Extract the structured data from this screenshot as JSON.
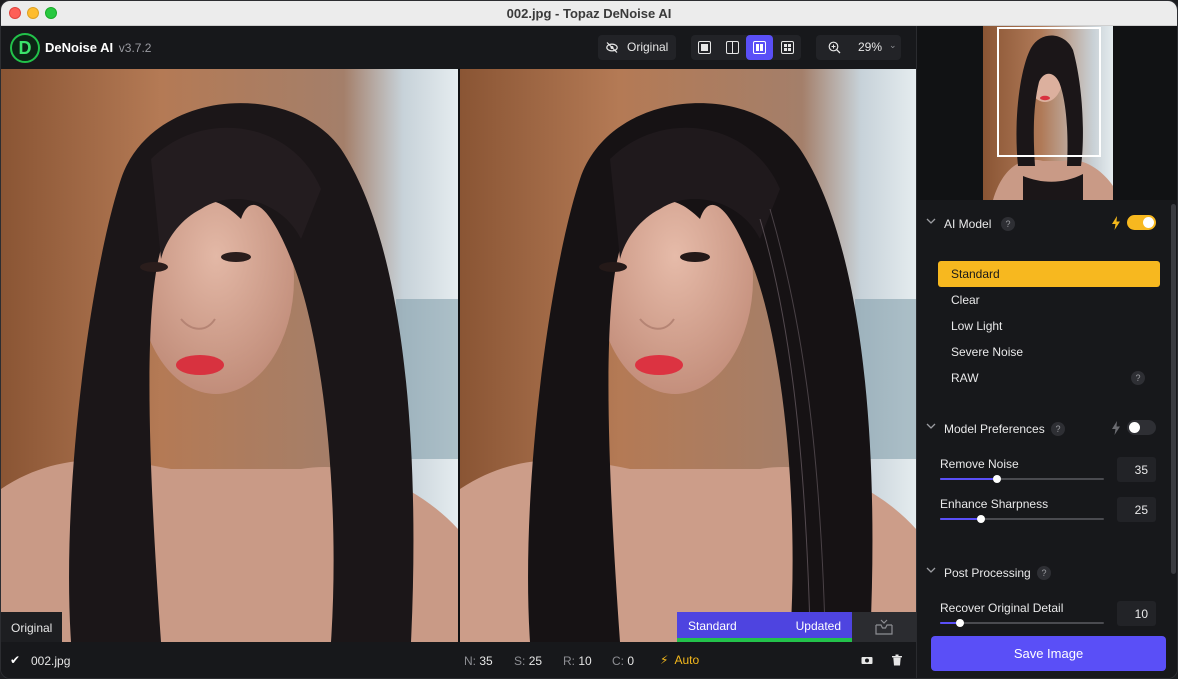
{
  "window": {
    "title": "002.jpg - Topaz DeNoise AI"
  },
  "app": {
    "name": "DeNoise AI",
    "version": "v3.7.2"
  },
  "toolbar": {
    "original_label": "Original",
    "zoom_value": "29%",
    "view_modes": [
      "single-view",
      "split-view",
      "side-by-side-view",
      "grid-view"
    ],
    "active_view": "side-by-side-view"
  },
  "preview": {
    "left_label": "Original",
    "right_model": "Standard",
    "right_status": "Updated"
  },
  "bottom": {
    "filename": "002.jpg",
    "stats": [
      {
        "key": "N:",
        "value": "35"
      },
      {
        "key": "S:",
        "value": "25"
      },
      {
        "key": "R:",
        "value": "10"
      },
      {
        "key": "C:",
        "value": "0"
      }
    ],
    "auto_label": "Auto"
  },
  "panel": {
    "ai_model": {
      "title": "AI Model",
      "help": "?",
      "auto_enabled": true,
      "models": [
        "Standard",
        "Clear",
        "Low Light",
        "Severe Noise",
        "RAW"
      ],
      "selected": "Standard",
      "raw_help": "?"
    },
    "preferences": {
      "title": "Model Preferences",
      "help": "?",
      "auto_enabled": false,
      "sliders": [
        {
          "label": "Remove Noise",
          "value": "35",
          "fraction": 0.35
        },
        {
          "label": "Enhance Sharpness",
          "value": "25",
          "fraction": 0.25
        }
      ]
    },
    "post": {
      "title": "Post Processing",
      "help": "?",
      "sliders": [
        {
          "label": "Recover Original Detail",
          "value": "10",
          "fraction": 0.12
        }
      ]
    },
    "save_label": "Save Image"
  },
  "colors": {
    "accent": "#5a4ff7",
    "selected_model": "#f7b81f",
    "processing_bar": "#23c14b",
    "auto": "#f5b91c"
  }
}
